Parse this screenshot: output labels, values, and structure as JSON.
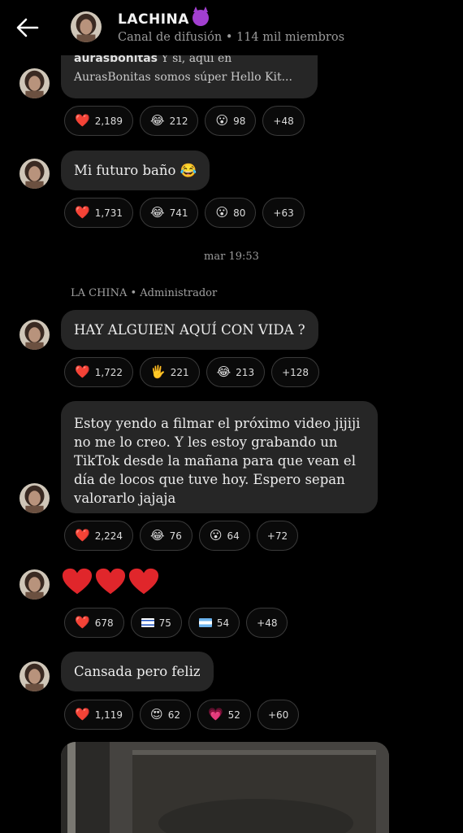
{
  "header": {
    "title": "LACHINA",
    "subtitle": "Canal de difusión • 114 mil miembros"
  },
  "messages": [
    {
      "quote_name": "aurasbonitas",
      "quote_rest": " Y sí, aquí en",
      "quote_line2": "AurasBonitas somos súper Hello Kit...",
      "reactions": [
        {
          "emoji": "❤️",
          "count": "2,189"
        },
        {
          "emoji": "😂",
          "count": "212"
        },
        {
          "emoji": "😮",
          "count": "98"
        },
        {
          "emoji": "",
          "count": "+48"
        }
      ]
    },
    {
      "text": "Mi futuro baño 😂",
      "reactions": [
        {
          "emoji": "❤️",
          "count": "1,731"
        },
        {
          "emoji": "😂",
          "count": "741"
        },
        {
          "emoji": "😮",
          "count": "80"
        },
        {
          "emoji": "",
          "count": "+63"
        }
      ]
    },
    {
      "text": "HAY ALGUIEN AQUÍ CON VIDA ?",
      "reactions": [
        {
          "emoji": "❤️",
          "count": "1,722"
        },
        {
          "emoji": "🖐",
          "count": "221"
        },
        {
          "emoji": "😂",
          "count": "213"
        },
        {
          "emoji": "",
          "count": "+128"
        }
      ]
    },
    {
      "lines": [
        "Estoy yendo a filmar el próximo video jijiji",
        "no me lo creo. Y les estoy grabando un",
        "TikTok desde la mañana para que vean el",
        "día de locos que tuve hoy. Espero sepan",
        "valorarlo jajaja"
      ],
      "reactions": [
        {
          "emoji": "❤️",
          "count": "2,224"
        },
        {
          "emoji": "😂",
          "count": "76"
        },
        {
          "emoji": "😮",
          "count": "64"
        },
        {
          "emoji": "",
          "count": "+72"
        }
      ]
    },
    {
      "hearts": "❤️❤️❤️",
      "reactions": [
        {
          "emoji": "❤️",
          "count": "678"
        },
        {
          "emoji": "flag-il",
          "count": "75"
        },
        {
          "emoji": "flag-ar",
          "count": "54"
        },
        {
          "emoji": "",
          "count": "+48"
        }
      ]
    },
    {
      "text": "Cansada pero feliz",
      "reactions": [
        {
          "emoji": "❤️",
          "count": "1,119"
        },
        {
          "emoji": "😍",
          "count": "62"
        },
        {
          "emoji": "💗",
          "count": "52"
        },
        {
          "emoji": "",
          "count": "+60"
        }
      ]
    }
  ],
  "date_separator": "mar 19:53",
  "author_label": "LA CHINA • Administrador",
  "colors": {
    "background": "#000000",
    "bubble": "#262626",
    "heart": "#e0262b"
  }
}
